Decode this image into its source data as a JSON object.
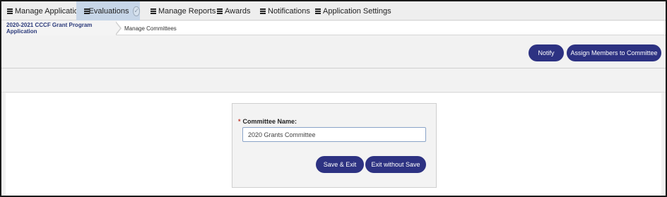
{
  "nav": {
    "items": [
      {
        "label": "Manage Applications"
      },
      {
        "label": "Evaluations"
      },
      {
        "label": "Manage Reports"
      },
      {
        "label": "Awards"
      },
      {
        "label": "Notifications"
      },
      {
        "label": "Application Settings"
      }
    ],
    "active_index": 1
  },
  "breadcrumb": {
    "items": [
      {
        "label": "2020-2021 CCCF Grant Program Application"
      },
      {
        "label": "Manage Committees"
      }
    ]
  },
  "actions": {
    "notify_label": "Notify",
    "assign_label": "Assign Members to Committee"
  },
  "form": {
    "required_mark": "*",
    "committee_label": "Committee Name:",
    "committee_value": "2020 Grants Committee",
    "save_label": "Save & Exit",
    "exit_label": "Exit without Save"
  },
  "colors": {
    "accent": "#2d3282",
    "active_tab": "#c7d6e8",
    "breadcrumb_link": "#2b3a7a",
    "required": "#c0392b"
  },
  "icons": {
    "menu": "hamburger-icon",
    "complete": "check-circle-icon"
  }
}
